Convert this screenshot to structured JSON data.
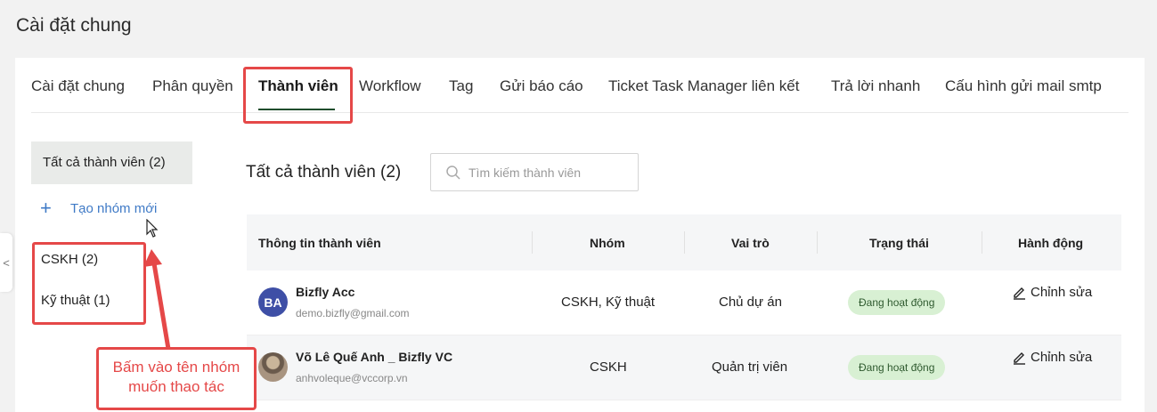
{
  "page": {
    "title": "Cài đặt chung"
  },
  "tabs": [
    {
      "label": "Cài đặt chung",
      "active": false
    },
    {
      "label": "Phân quyền",
      "active": false
    },
    {
      "label": "Thành viên",
      "active": true
    },
    {
      "label": "Workflow",
      "active": false
    },
    {
      "label": "Tag",
      "active": false
    },
    {
      "label": "Gửi báo cáo",
      "active": false
    },
    {
      "label": "Ticket Task Manager liên kết",
      "active": false
    },
    {
      "label": "Trả lời nhanh",
      "active": false
    },
    {
      "label": "Cấu hình gửi mail smtp",
      "active": false
    }
  ],
  "sidebar": {
    "all_members": "Tất cả thành viên (2)",
    "create_group": "Tạo nhóm mới",
    "groups": [
      "CSKH (2)",
      "Kỹ thuật (1)"
    ]
  },
  "main": {
    "title": "Tất cả thành viên (2)",
    "search_placeholder": "Tìm kiếm thành viên"
  },
  "table": {
    "headers": [
      "Thông tin thành viên",
      "Nhóm",
      "Vai trò",
      "Trạng thái",
      "Hành động"
    ],
    "rows": [
      {
        "initials": "BA",
        "name": "Bizfly Acc",
        "email": "demo.bizfly@gmail.com",
        "group": "CSKH, Kỹ thuật",
        "role": "Chủ dự án",
        "status": "Đang hoạt động",
        "action": "Chỉnh sửa"
      },
      {
        "initials": "",
        "name": "Võ Lê Quế Anh _ Bizfly VC",
        "email": "anhvoleque@vccorp.vn",
        "group": "CSKH",
        "role": "Quản trị viên",
        "status": "Đang hoạt động",
        "action": "Chỉnh sửa"
      }
    ]
  },
  "annotation": {
    "callout_line1": "Bấm vào tên nhóm",
    "callout_line2": "muốn thao tác",
    "color": "#e54848"
  },
  "collapse_glyph": "<"
}
